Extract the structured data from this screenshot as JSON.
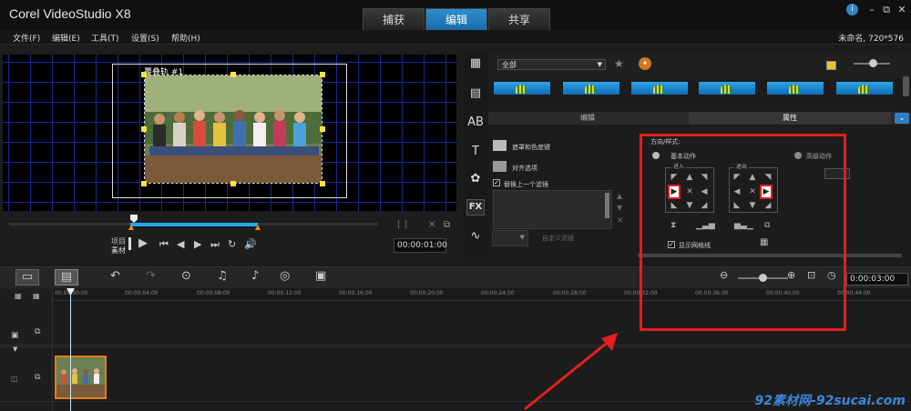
{
  "app": {
    "title": "Corel VideoStudio X8"
  },
  "tabs": [
    {
      "label": "捕获",
      "active": false
    },
    {
      "label": "编辑",
      "active": true
    },
    {
      "label": "共享",
      "active": false
    }
  ],
  "menu": [
    "文件(F)",
    "编辑(E)",
    "工具(T)",
    "设置(S)",
    "帮助(H)"
  ],
  "project_info": "未命名, 720*576",
  "window_controls": {
    "info": "i",
    "minimize": "–",
    "restore": "⧉",
    "close": "✕"
  },
  "preview": {
    "track_label": "覆叠轨 #1",
    "mode_project": "项目",
    "mode_clip": "素材",
    "timecode": "00:00:01:00"
  },
  "library": {
    "category": "全部",
    "thumb_count": 6,
    "options_tabs": {
      "edit": "编辑",
      "attribute": "属性"
    }
  },
  "attribute_options": {
    "mask_chroma": "遮罩和色度键",
    "align_options": "对齐选项",
    "replace_filter": "替换上一个滤镜",
    "replace_filter_checked": true,
    "custom_filter": "自定义滤镜"
  },
  "direction": {
    "title": "方向/样式:",
    "basic": "基本动作",
    "advanced": "高级动作",
    "enter": "进入",
    "exit": "退出",
    "show_grid": "显示网格线",
    "show_grid_checked": true
  },
  "timeline": {
    "timecode": "0:00:03:00",
    "zoom_level": 0.45,
    "ruler": [
      "00:00:00:00",
      "00:00:04:00",
      "00:00:08:00",
      "00:00:12:00",
      "00:00:16:00",
      "00:00:20:00",
      "00:00:24:00",
      "00:00:28:00",
      "00:00:32:00",
      "00:00:36:00",
      "00:00:40:00",
      "00:00:44:00"
    ]
  },
  "watermark": "92素材网-92sucai.com",
  "colors": {
    "accent": "#1b6aa5",
    "annotation": "#e21e1e",
    "clip_border": "#e57d16",
    "handle": "#ffe23a"
  }
}
